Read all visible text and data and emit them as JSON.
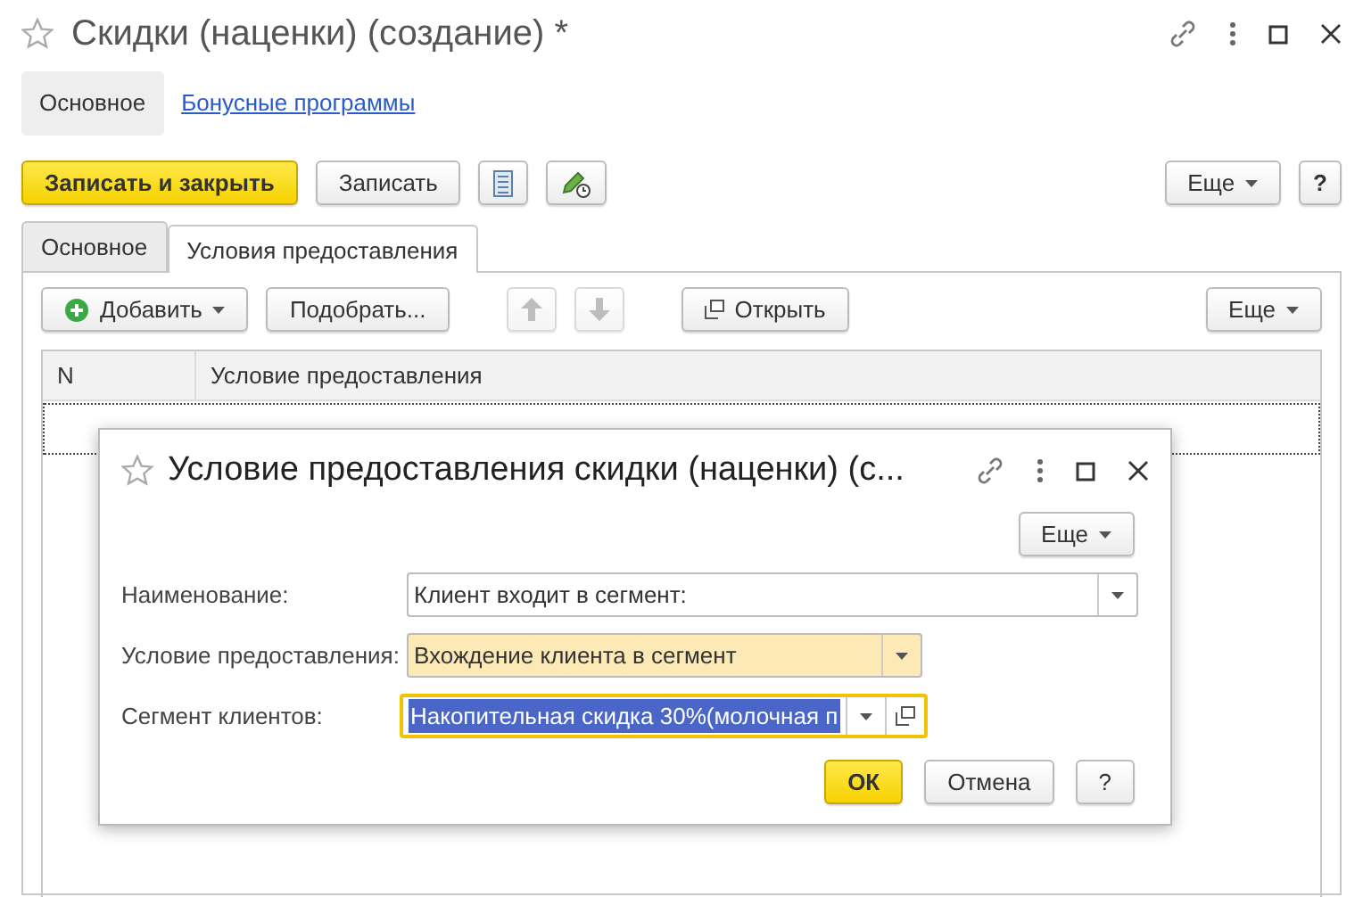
{
  "window": {
    "title": "Скидки (наценки) (создание) *"
  },
  "nav": [
    {
      "label": "Основное",
      "selected": true
    },
    {
      "label": "Бонусные программы",
      "selected": false
    }
  ],
  "toolbar": {
    "save_close": "Записать и закрыть",
    "save": "Записать",
    "more": "Еще",
    "help": "?"
  },
  "tabs": [
    {
      "label": "Основное",
      "selected": false
    },
    {
      "label": "Условия предоставления",
      "selected": true
    }
  ],
  "table_toolbar": [
    {
      "kind": "menu",
      "label": "Добавить"
    },
    {
      "kind": "text",
      "label": "Подобрать..."
    },
    {
      "kind": "up",
      "disabled": true
    },
    {
      "kind": "down",
      "disabled": true
    },
    {
      "kind": "open",
      "label": "Открыть"
    }
  ],
  "table_more": "Еще",
  "table": {
    "columns": [
      "N",
      "Условие предоставления"
    ]
  },
  "dialog": {
    "title": "Условие предоставления скидки (наценки) (с...",
    "more": "Еще",
    "fields": [
      {
        "label": "Наименование:",
        "value": "Клиент входит в сегмент:",
        "highlighted": false,
        "focused": false
      },
      {
        "label": "Условие предоставления:",
        "value": "Вхождение клиента в сегмент",
        "highlighted": true,
        "focused": false
      },
      {
        "label": "Сегмент клиентов:",
        "value": "Накопительная скидка 30%(молочная п",
        "highlighted": false,
        "focused": true
      }
    ],
    "buttons": [
      {
        "kind": "primary",
        "label": "ОК"
      },
      {
        "kind": "default",
        "label": "Отмена"
      },
      {
        "kind": "default",
        "label": "?"
      }
    ]
  }
}
